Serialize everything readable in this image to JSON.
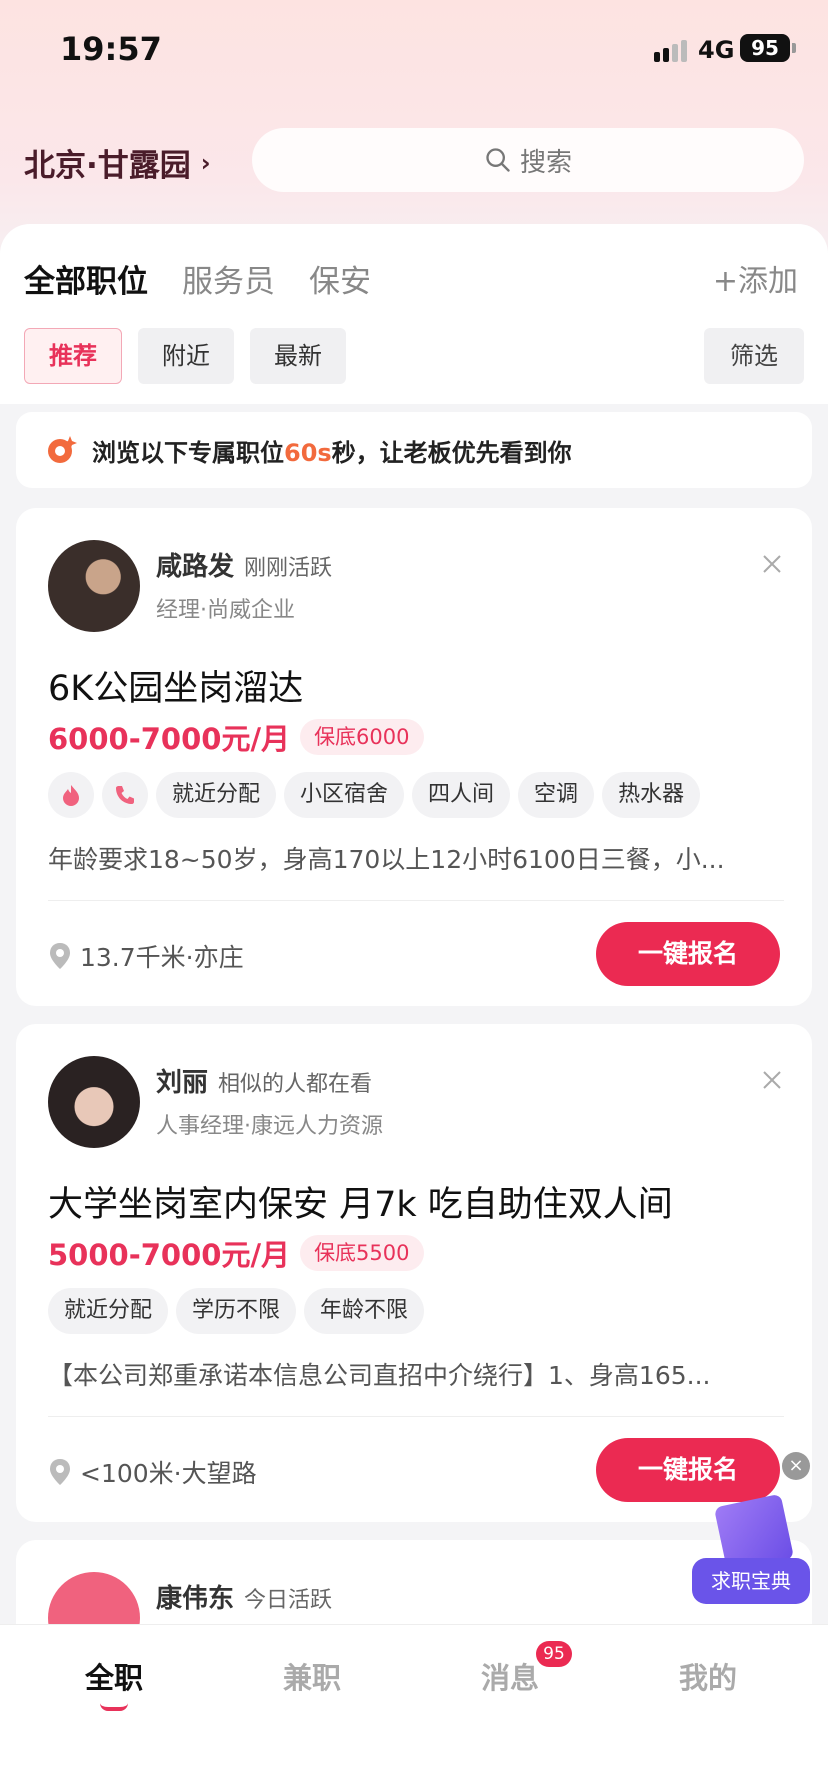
{
  "status_bar": {
    "time": "19:57",
    "network": "4G",
    "battery": "95"
  },
  "header": {
    "location": "北京·甘露园",
    "search_placeholder": "搜索"
  },
  "job_tabs": {
    "items": [
      "全部职位",
      "服务员",
      "保安"
    ],
    "add_label": "+添加"
  },
  "filters": {
    "items": [
      "推荐",
      "附近",
      "最新"
    ],
    "filter_label": "筛选"
  },
  "promo": {
    "text_before": "浏览以下专属职位",
    "highlight": "60s",
    "text_after": "秒，让老板优先看到你"
  },
  "jobs": [
    {
      "name": "咸路发",
      "activity": "刚刚活跃",
      "role": "经理·尚威企业",
      "title": "6K公园坐岗溜达",
      "salary": "6000-7000元/月",
      "guarantee": "保底6000",
      "tags": [
        "就近分配",
        "小区宿舍",
        "四人间",
        "空调",
        "热水器"
      ],
      "description": "年龄要求18~50岁，身高170以上12小时6100日三餐，小...",
      "location": "13.7千米·亦庄",
      "apply_label": "一键报名"
    },
    {
      "name": "刘丽",
      "activity": "相似的人都在看",
      "role": "人事经理·康远人力资源",
      "title": "大学坐岗室内保安  月7k  吃自助住双人间",
      "salary": "5000-7000元/月",
      "guarantee": "保底5500",
      "tags": [
        "就近分配",
        "学历不限",
        "年龄不限"
      ],
      "description": "【本公司郑重承诺本信息公司直招中介绕行】1、身高165...",
      "location": "<100米·大望路",
      "apply_label": "一键报名"
    },
    {
      "name": "康伟东",
      "activity": "今日活跃"
    }
  ],
  "floating_guide": {
    "label": "求职宝典"
  },
  "bottom_nav": {
    "items": [
      "全职",
      "兼职",
      "消息",
      "我的"
    ],
    "message_badge": "95"
  },
  "colors": {
    "accent": "#eb2a52",
    "promo_highlight": "#f26a3d",
    "guide": "#6a54e9"
  }
}
